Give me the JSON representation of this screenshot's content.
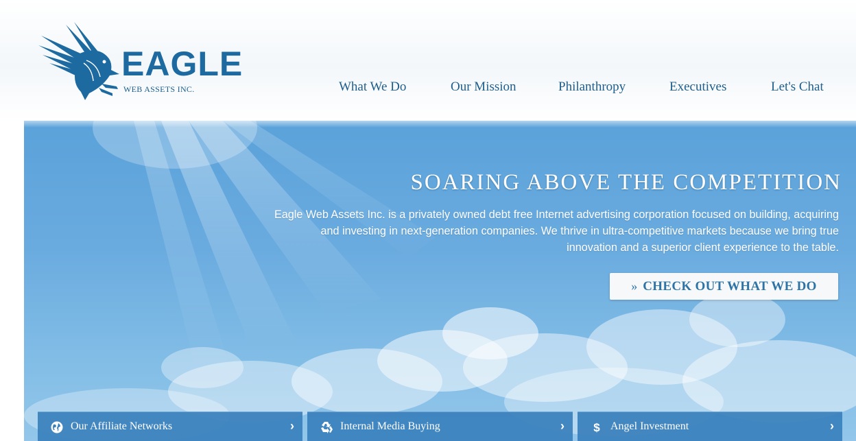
{
  "brand": {
    "name": "EAGLE",
    "tagline": "WEB ASSETS INC.",
    "color": "#1d6aa0"
  },
  "nav": {
    "items": [
      {
        "label": "What We Do"
      },
      {
        "label": "Our Mission"
      },
      {
        "label": "Philanthropy"
      },
      {
        "label": "Executives"
      },
      {
        "label": "Let's Chat"
      }
    ]
  },
  "hero": {
    "title": "SOARING ABOVE THE COMPETITION",
    "text": "Eagle Web Assets Inc. is a privately owned debt free Internet advertising corporation focused on building, acquiring and investing in next-generation companies. We thrive in ultra-competitive markets because we bring true innovation and a superior client experience to the table.",
    "cta": {
      "arrow": "»",
      "label": "CHECK OUT WHAT WE DO"
    }
  },
  "tabs": [
    {
      "label": "Our Affiliate Networks",
      "icon": "globe-icon",
      "chevron": "›"
    },
    {
      "label": "Internal Media Buying",
      "icon": "recycle-icon",
      "chevron": "›"
    },
    {
      "label": "Angel Investment",
      "icon": "dollar-icon",
      "chevron": "›"
    }
  ],
  "colors": {
    "accent": "#1e5d8c",
    "sky": "#6aabdf",
    "tab": "#3a80bc",
    "cta_text": "#2e73a6"
  }
}
